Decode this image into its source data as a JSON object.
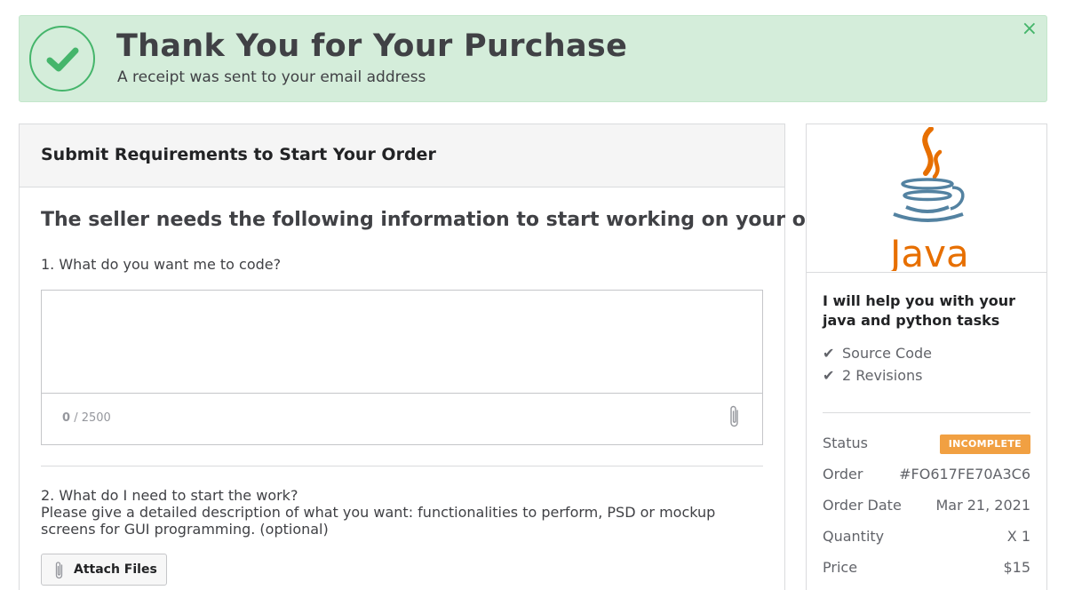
{
  "banner": {
    "title": "Thank You for Your Purchase",
    "subtitle": "A receipt was sent to your email address",
    "close_label": "×",
    "color": "#45b56b",
    "background": "#d4edda"
  },
  "requirements": {
    "header_title": "Submit Requirements to Start Your Order",
    "lead": "The seller needs the following information to start working on your order:",
    "question1": {
      "label": "1.  What do you want me to code?",
      "value": "",
      "counter_current": "0",
      "counter_max": "/ 2500"
    },
    "question2": {
      "label": "2.  What do I need to start the work?",
      "description": "Please give a detailed description of what you want: functionalities to perform, PSD or mockup screens for GUI programming. (optional)"
    },
    "attach_button_label": "Attach Files"
  },
  "order_summary": {
    "logo_text": "Java",
    "gig_title": "I will help you with your java and python tasks",
    "features": [
      "Source Code",
      "2 Revisions"
    ],
    "status_label": "Status",
    "status_value": "INCOMPLETE",
    "status_color": "#f1a042",
    "order_label": "Order",
    "order_value": "#FO617FE70A3C6",
    "order_date_label": "Order Date",
    "order_date_value": "Mar 21, 2021",
    "quantity_label": "Quantity",
    "quantity_value": "X 1",
    "price_label": "Price",
    "price_value": "$15"
  }
}
